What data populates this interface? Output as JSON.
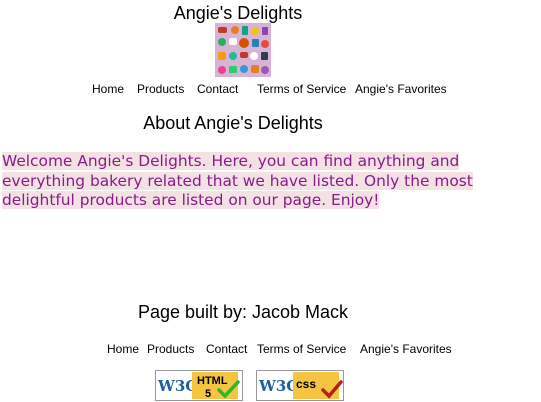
{
  "header": {
    "site_title": "Angie's Delights"
  },
  "nav_top": {
    "items": [
      "Home",
      "Products",
      "Contact",
      "Terms of Service",
      "Angie's Favorites"
    ]
  },
  "main": {
    "heading": "About Angie's Delights",
    "welcome_text": "Welcome Angie's Delights. Here, you can find anything and everything bakery related that we have listed. Only the most delightful products are listed on our page. Enjoy!"
  },
  "footer": {
    "built_by": "Page built by: Jacob Mack",
    "nav_items": [
      "Home",
      "Products",
      "Contact",
      "Terms of Service",
      "Angie's Favorites"
    ],
    "badges": [
      {
        "icon": "w3c-html5-valid-badge",
        "w3c": "W3C",
        "label": "HTML",
        "sub": "5"
      },
      {
        "icon": "w3c-css-valid-badge",
        "w3c": "W3C",
        "label": "css"
      }
    ]
  },
  "colors": {
    "welcome_text": "#8a1c8a",
    "welcome_highlight": "#f3e1e4",
    "logo_background": "#d7b3d6",
    "badge_gold": "#f5c542",
    "badge_blue": "#1d5fa0",
    "check_green": "#2bb82b",
    "check_red": "#b32020"
  }
}
